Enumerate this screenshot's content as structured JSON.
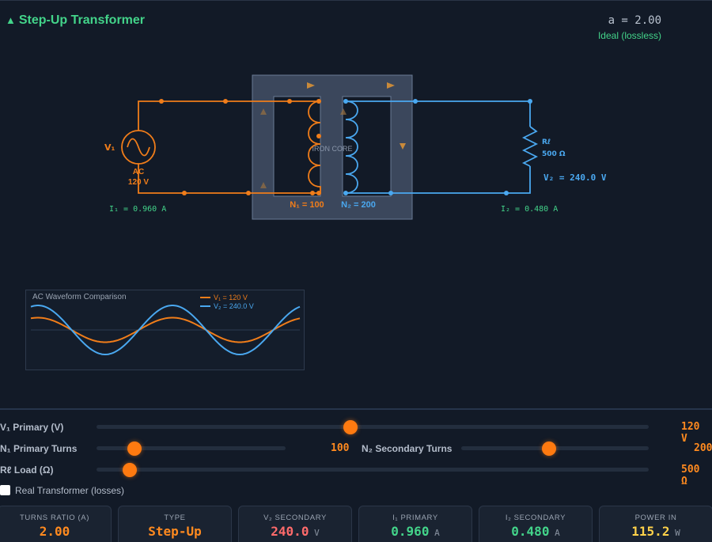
{
  "header": {
    "title": "Step-Up Transformer",
    "ratio_text": "a = 2.00",
    "mode_text": "Ideal (lossless)"
  },
  "circuit": {
    "source_label": "V₁",
    "source_type": "AC",
    "source_voltage": "120 V",
    "core_label": "IRON CORE",
    "n1_label": "N₁ = 100",
    "n2_label": "N₂ = 200",
    "load_label": "Rℓ",
    "load_value": "500 Ω",
    "v2_label": "V₂ = 240.0 V",
    "i1_label": "I₁ = 0.960 A",
    "i2_label": "I₂ = 0.480 A",
    "colors": {
      "primary": "#f07d1a",
      "secondary": "#4aa8f0",
      "core": "#5c6d88"
    }
  },
  "waveform": {
    "title": "AC Waveform Comparison",
    "v1_legend": "V₁ = 120 V",
    "v2_legend": "V₂ = 240.0 V",
    "v1_amplitude": 120,
    "v2_amplitude": 240
  },
  "controls": {
    "v1": {
      "label": "V₁ Primary (V)",
      "value": "120 V",
      "fraction": 0.46
    },
    "n1": {
      "label": "N₁ Primary Turns",
      "value": "100",
      "fraction": 0.2
    },
    "n2": {
      "label": "N₂ Secondary Turns",
      "value": "200",
      "fraction": 0.47
    },
    "load": {
      "label": "Rℓ Load (Ω)",
      "value": "500 Ω",
      "fraction": 0.06
    },
    "real_checkbox": {
      "label": "Real Transformer (losses)",
      "checked": false
    }
  },
  "cards": [
    {
      "label": "TURNS RATIO (A)",
      "value": "2.00",
      "unit": "",
      "color": "#ff8a1f"
    },
    {
      "label": "TYPE",
      "value": "Step-Up",
      "unit": "",
      "color": "#ff8a1f"
    },
    {
      "label": "V₂ SECONDARY",
      "value": "240.0",
      "unit": "V",
      "color": "#ff6b6b"
    },
    {
      "label": "I₁ PRIMARY",
      "value": "0.960",
      "unit": "A",
      "color": "#43d48a"
    },
    {
      "label": "I₂ SECONDARY",
      "value": "0.480",
      "unit": "A",
      "color": "#43d48a"
    },
    {
      "label": "POWER IN",
      "value": "115.2",
      "unit": "W",
      "color": "#ffd24a"
    }
  ]
}
